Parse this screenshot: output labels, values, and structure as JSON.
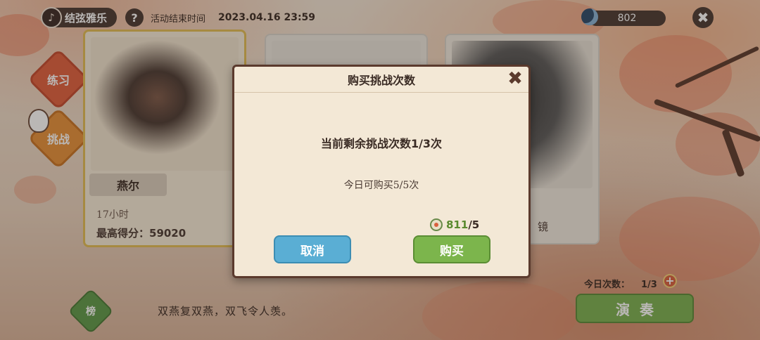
{
  "header": {
    "event_name": "结弦雅乐",
    "help_symbol": "?",
    "event_end_label": "活动结束时间",
    "event_end_time": "2023.04.16 23:59",
    "currency_amount": "802",
    "close_symbol": "✖"
  },
  "side": {
    "practice_label": "练习",
    "challenge_label": "挑战"
  },
  "cards": [
    {
      "name": "燕尔",
      "duration": "17小时",
      "score_label": "最高得分：59020"
    },
    {
      "lock_text": "镜"
    }
  ],
  "bottom": {
    "rank_label": "榜",
    "poem": "双燕复双燕，双飞令人羡。",
    "today_label": "今日次数：",
    "today_value": "1/3",
    "plus_symbol": "+",
    "play_label": "演奏"
  },
  "modal": {
    "title": "购买挑战次数",
    "close_symbol": "✖",
    "remaining_text": "当前剩余挑战次数1/3次",
    "purchasable_text": "今日可购买5/5次",
    "cost_have": "811",
    "cost_need": "/5",
    "cancel_label": "取消",
    "buy_label": "购买"
  },
  "colors": {
    "dark_pill": "#4a3a33",
    "practice": "#e0603f",
    "challenge": "#e6913a",
    "cancel_blue": "#5aaed4",
    "buy_green": "#7cb54c"
  }
}
